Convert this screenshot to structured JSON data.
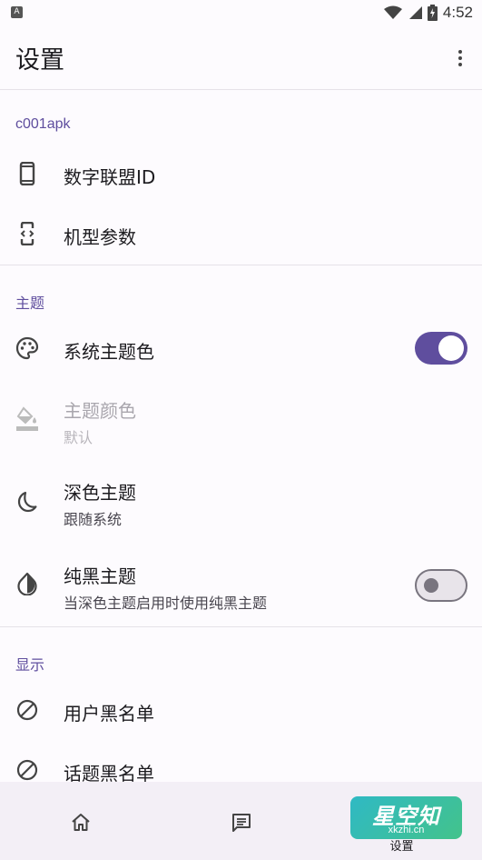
{
  "status_bar": {
    "left_icon": "A",
    "icons": [
      "wifi-icon",
      "signal-icon",
      "battery-charging-icon"
    ],
    "time": "4:52"
  },
  "app_bar": {
    "title": "设置",
    "menu_icon": "more-vert-icon"
  },
  "sections": {
    "c001apk": {
      "header": "c001apk",
      "items": [
        {
          "title": "数字联盟ID",
          "icon": "smartphone-icon"
        },
        {
          "title": "机型参数",
          "icon": "developer-mode-icon"
        }
      ]
    },
    "theme": {
      "header": "主题",
      "items": [
        {
          "title": "系统主题色",
          "icon": "palette-icon",
          "switch_on": true
        },
        {
          "title": "主题颜色",
          "summary": "默认",
          "icon": "format-color-fill-icon",
          "enabled": false
        },
        {
          "title": "深色主题",
          "summary": "跟随系统",
          "icon": "dark-mode-moon-icon"
        },
        {
          "title": "纯黑主题",
          "summary": "当深色主题启用时使用纯黑主题",
          "icon": "contrast-icon",
          "switch_on": false
        }
      ]
    },
    "display": {
      "header": "显示",
      "items": [
        {
          "title": "用户黑名单",
          "icon": "block-icon"
        },
        {
          "title": "话题黑名单",
          "icon": "block-icon"
        }
      ]
    }
  },
  "bottom_nav": {
    "items": [
      {
        "label": "",
        "icon": "home-icon"
      },
      {
        "label": "",
        "icon": "message-icon"
      },
      {
        "label": "设置",
        "icon": "settings-icon",
        "selected": true
      }
    ]
  },
  "watermark": {
    "main": "星空知",
    "sub": "xkzhi.cn"
  },
  "colors": {
    "accent": "#5f4e9e",
    "background": "#fdfbfe",
    "nav_background": "#f3eff6"
  }
}
